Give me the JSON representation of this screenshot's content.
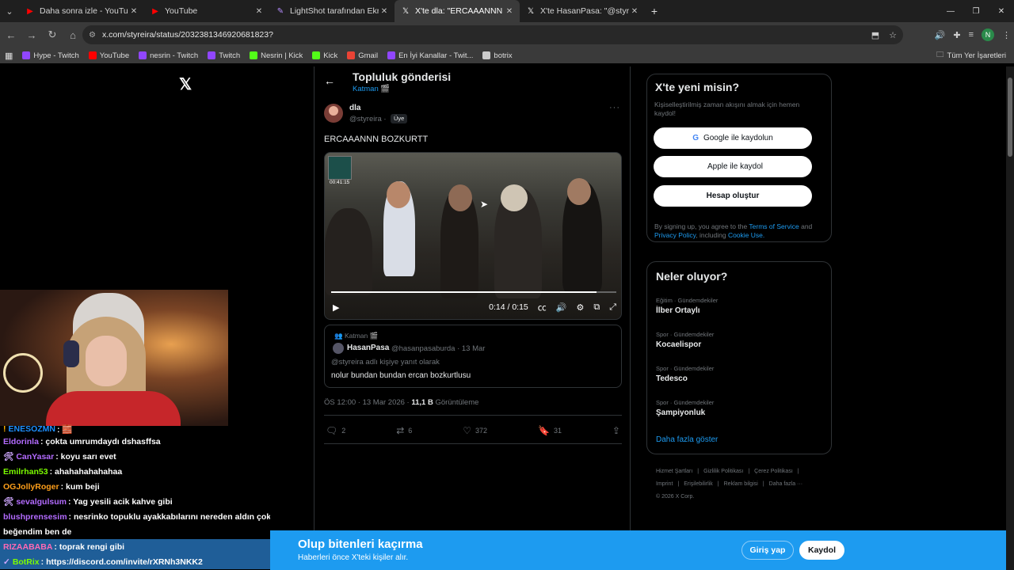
{
  "browser": {
    "tabs": [
      {
        "title": "Daha sonra izle - YouTube",
        "icon": "youtube-icon",
        "active": false
      },
      {
        "title": "YouTube",
        "icon": "youtube-icon",
        "active": false
      },
      {
        "title": "LightShot tarafından Ekran Gö...",
        "icon": "lightshot-icon",
        "active": false
      },
      {
        "title": "X'te dla: \"ERCAAANNN BOZKU...",
        "icon": "x-icon",
        "active": true
      },
      {
        "title": "X'te HasanPasa: \"@styreira nol...",
        "icon": "x-icon",
        "active": false
      }
    ],
    "url": "x.com/styreira/status/2032381346920681823?",
    "bookmarks": [
      {
        "label": "Hype - Twitch",
        "color": "#9146ff"
      },
      {
        "label": "YouTube",
        "color": "#ff0000"
      },
      {
        "label": "nesrin - Twitch",
        "color": "#9146ff"
      },
      {
        "label": "Twitch",
        "color": "#9146ff"
      },
      {
        "label": "Nesrin | Kick",
        "color": "#53fc18"
      },
      {
        "label": "Kick",
        "color": "#53fc18"
      },
      {
        "label": "Gmail",
        "color": "#ea4335"
      },
      {
        "label": "En İyi Kanallar - Twit...",
        "color": "#9146ff"
      },
      {
        "label": "botrix",
        "color": "#cccccc"
      }
    ],
    "all_bookmarks": "Tüm Yer İşaretleri",
    "profile_initial": "N"
  },
  "header": {
    "title": "Topluluk gönderisi",
    "community": "Katman 🎬"
  },
  "post": {
    "author_name": "dla",
    "author_handle": "@styreira ·",
    "badge": "Üye",
    "text": "ERCAAANNN BOZKURTT",
    "video": {
      "current_time": "0:14 / 0:15",
      "thumb_time": "00:41:15",
      "progress": 0.93
    },
    "quote": {
      "community": "Katman 🎬",
      "name": "HasanPasa",
      "handle": "@hasanpasaburda · 13 Mar",
      "reply_to": "@styreira adlı kişiye yanıt olarak",
      "text": "nolur bundan bundan ercan bozkurtlusu"
    },
    "meta_time": "ÖS 12:00 · 13 Mar 2026 ·",
    "views": "11,1 B",
    "views_label": "Görüntüleme",
    "counts": {
      "replies": "2",
      "reposts": "6",
      "likes": "372",
      "bookmarks": "31"
    }
  },
  "signup": {
    "title": "X'te yeni misin?",
    "desc": "Kişiselleştirilmiş zaman akışını almak için hemen kaydol!",
    "google": "Google ile kaydolun",
    "apple": "Apple ile kaydol",
    "create": "Hesap oluştur",
    "terms_pre": "By signing up, you agree to the",
    "terms_link": "Terms of Service",
    "terms_and": "and",
    "privacy_link": "Privacy Policy",
    "terms_including": ", including",
    "cookie_link": "Cookie Use."
  },
  "trends": {
    "title": "Neler oluyor?",
    "items": [
      {
        "category": "Eğitim · Gündemdekiler",
        "name": "İlber Ortaylı"
      },
      {
        "category": "Spor · Gündemdekiler",
        "name": "Kocaelispor"
      },
      {
        "category": "Spor · Gündemdekiler",
        "name": "Tedesco"
      },
      {
        "category": "Spor · Gündemdekiler",
        "name": "Şampiyonluk"
      }
    ],
    "show_more": "Daha fazla göster"
  },
  "footer": {
    "line1": [
      "Hizmet Şartları",
      "|",
      "Gizlilik Politikası",
      "|",
      "Çerez Politikası",
      "|"
    ],
    "line2": [
      "Imprint",
      "|",
      "Erişilebilirlik",
      "|",
      "Reklam bilgisi",
      "|",
      "Daha fazla ···"
    ],
    "copyright": "© 2026 X Corp."
  },
  "chat": [
    {
      "user": "ENESOZMN",
      "color": "#1e90ff",
      "text": ": 🧱",
      "icon": "!"
    },
    {
      "user": "Eldorinla",
      "color": "#b36bff",
      "text": ": çokta umrumdaydı dshasffsa",
      "icon": ""
    },
    {
      "user": "CanYasar",
      "color": "#b36bff",
      "text": ": koyu sarı evet",
      "icon": "🛠"
    },
    {
      "user": "Emilrhan53",
      "color": "#7cfc00",
      "text": ": ahahahahahahaa",
      "icon": ""
    },
    {
      "user": "OGJollyRoger",
      "color": "#ff9f1a",
      "text": ": kum beji",
      "icon": ""
    },
    {
      "user": "sevalgulsum",
      "color": "#b36bff",
      "text": ": Yag yesili acik kahve gibi",
      "icon": "🛠"
    },
    {
      "user": "blushprensesim",
      "color": "#b36bff",
      "text": ": nesrinko topuklu ayakkabılarını nereden aldın çok",
      "icon": ""
    },
    {
      "user": "",
      "color": "#ffffff",
      "text": "beğendim ben de",
      "icon": ""
    },
    {
      "user": "RIZAABABA",
      "color": "#ff69b4",
      "text": ": toprak rengi gibi",
      "icon": ""
    },
    {
      "user": "BotRix",
      "color": "#7cfc00",
      "text": ": https://discord.com/invite/rXRNh3NKK2",
      "icon": "✓"
    }
  ],
  "banner": {
    "title": "Olup bitenleri kaçırma",
    "subtitle": "Haberleri önce X'teki kişiler alır.",
    "login": "Giriş yap",
    "register": "Kaydol"
  }
}
